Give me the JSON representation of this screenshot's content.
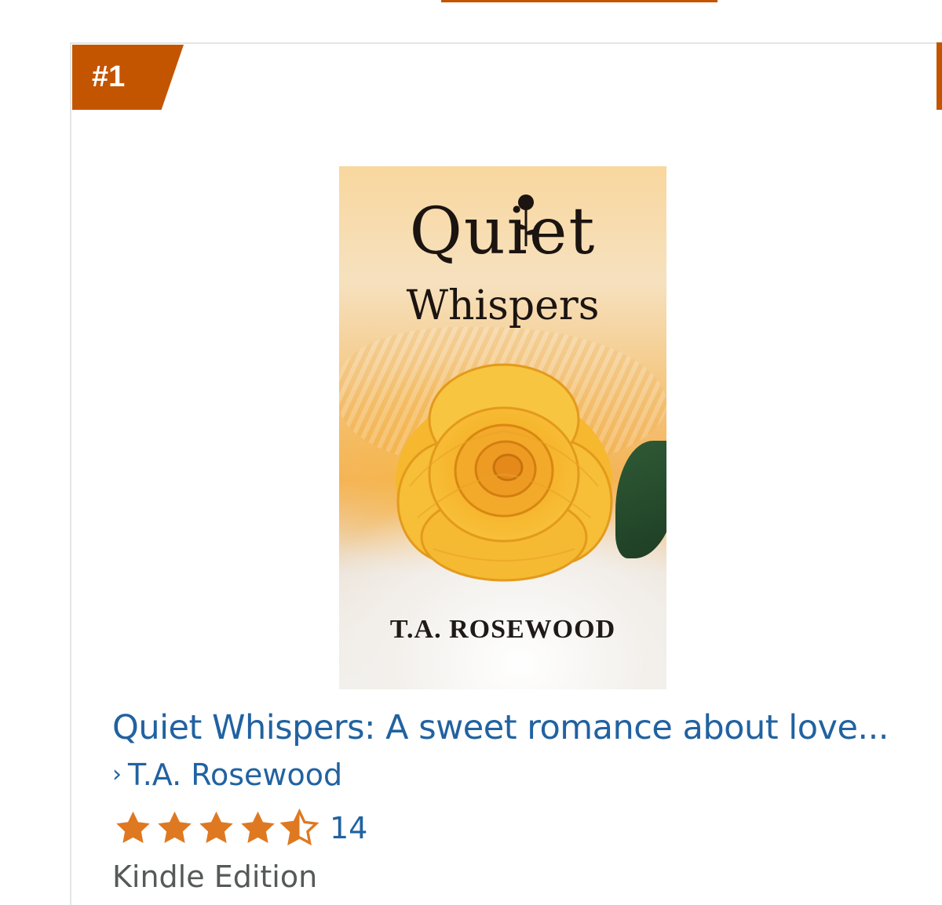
{
  "rank": {
    "label": "#1"
  },
  "book": {
    "cover": {
      "title_line1": "Quiet",
      "title_line2": "Whispers",
      "author": "T.A. ROSEWOOD"
    },
    "title": "Quiet Whispers: A sweet romance about love...",
    "author_prefix": "›",
    "author": "T.A. Rosewood",
    "rating": {
      "stars": 4.5,
      "max_stars": 5,
      "count": "14"
    },
    "format": "Kindle Edition"
  },
  "colors": {
    "badge": "#c45500",
    "link": "#2162a1",
    "star": "#de7921",
    "muted_text": "#565959"
  }
}
